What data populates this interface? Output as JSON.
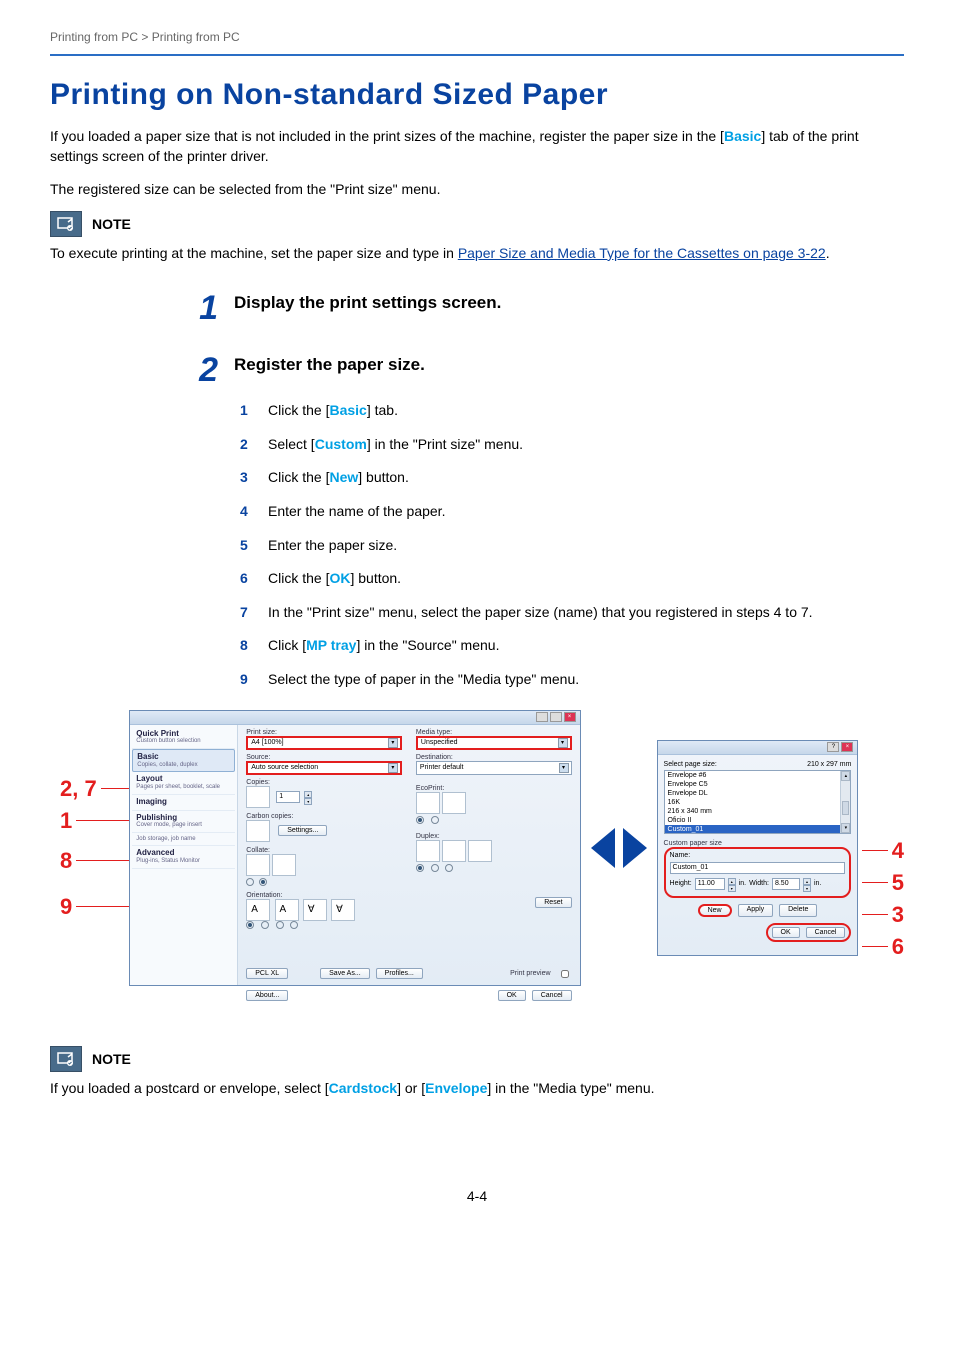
{
  "breadcrumb": "Printing from PC > Printing from PC",
  "title": "Printing on Non-standard Sized Paper",
  "intro_pre": "If you loaded a paper size that is not included in the print sizes of the machine, register the paper size in the [",
  "intro_link": "Basic",
  "intro_post": "] tab of the print settings screen of the printer driver.",
  "intro2": "The registered size can be selected from the \"Print size\" menu.",
  "note_label": "NOTE",
  "note1_pre": "To execute printing at the machine, set the paper size and type in ",
  "note1_link": "Paper Size and Media Type for the Cassettes on page 3-22",
  "note1_post": ".",
  "step1_num": "1",
  "step1_title": "Display the print settings screen.",
  "step2_num": "2",
  "step2_title": "Register the paper size.",
  "subs": [
    {
      "n": "1",
      "pre": "Click the [",
      "link": "Basic",
      "post": "] tab."
    },
    {
      "n": "2",
      "pre": "Select [",
      "link": "Custom",
      "post": "] in the \"Print size\" menu."
    },
    {
      "n": "3",
      "pre": "Click the [",
      "link": "New",
      "post": "] button."
    },
    {
      "n": "4",
      "pre": "Enter the name of the paper.",
      "link": "",
      "post": ""
    },
    {
      "n": "5",
      "pre": "Enter the paper size.",
      "link": "",
      "post": ""
    },
    {
      "n": "6",
      "pre": "Click the [",
      "link": "OK",
      "post": "] button."
    },
    {
      "n": "7",
      "pre": "In the \"Print size\" menu, select the paper size (name) that you registered in steps 4 to 7.",
      "link": "",
      "post": ""
    },
    {
      "n": "8",
      "pre": "Click [",
      "link": "MP tray",
      "post": "] in the \"Source\" menu."
    },
    {
      "n": "9",
      "pre": "Select the type of paper in the \"Media type\" menu.",
      "link": "",
      "post": ""
    }
  ],
  "callouts_left": [
    "2, 7",
    "1",
    "8",
    "9"
  ],
  "callouts_right": [
    "4",
    "5",
    "3",
    "6"
  ],
  "dlg": {
    "nav": [
      {
        "h": "Quick Print",
        "s": "Custom button selection"
      },
      {
        "h": "Basic",
        "s": "Copies, collate, duplex"
      },
      {
        "h": "Layout",
        "s": "Pages per sheet, booklet, scale"
      },
      {
        "h": "Imaging",
        "s": ""
      },
      {
        "h": "Publishing",
        "s": "Cover mode, page insert"
      },
      {
        "h": "Job storage, job name",
        "s": ""
      },
      {
        "h": "Advanced",
        "s": "Plug-ins, Status Monitor"
      }
    ],
    "print_size_label": "Print size:",
    "print_size_value": "A4  [100%]",
    "source_label": "Source:",
    "source_value": "Auto source selection",
    "media_label": "Media type:",
    "media_value": "Unspecified",
    "dest_label": "Destination:",
    "dest_value": "Printer default",
    "copies_label": "Copies:",
    "copies_value": "1",
    "carbon_label": "Carbon copies:",
    "settings_btn": "Settings...",
    "ecoprint_label": "EcoPrint:",
    "collate_label": "Collate:",
    "duplex_label": "Duplex:",
    "orient_label": "Orientation:",
    "reset_btn": "Reset",
    "pcl_btn": "PCL XL",
    "saveas_btn": "Save As...",
    "profiles_btn": "Profiles...",
    "preview_label": "Print preview",
    "about_btn": "About...",
    "ok_btn": "OK",
    "cancel_btn": "Cancel"
  },
  "dlg2": {
    "title_label": "Select page size:",
    "title_size": "210 x 297 mm",
    "list": [
      "Envelope #6",
      "Envelope C5",
      "Envelope DL",
      "16K",
      "216 x 340 mm",
      "Oficio II",
      "Custom_01"
    ],
    "custom_label": "Custom paper size",
    "name_label": "Name:",
    "name_value": "Custom_01",
    "height_label": "Height:",
    "height_value": "11.00",
    "width_label": "Width:",
    "width_value": "8.50",
    "unit": "in.",
    "new_btn": "New",
    "apply_btn": "Apply",
    "delete_btn": "Delete",
    "ok_btn": "OK",
    "cancel_btn": "Cancel"
  },
  "note2_pre": "If you loaded a postcard or envelope, select [",
  "note2_link1": "Cardstock",
  "note2_mid": "] or [",
  "note2_link2": "Envelope",
  "note2_post": "] in the \"Media type\" menu.",
  "pagenum": "4-4"
}
